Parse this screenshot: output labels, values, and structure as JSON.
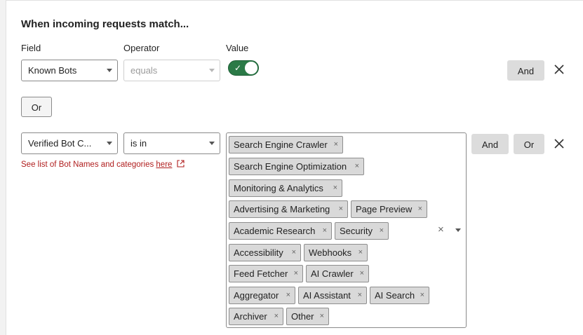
{
  "section": {
    "title": "When incoming requests match..."
  },
  "labels": {
    "field": "Field",
    "operator": "Operator",
    "value": "Value"
  },
  "row1": {
    "field": "Known Bots",
    "operator": "equals",
    "toggle_on": true,
    "and_label": "And"
  },
  "or_label": "Or",
  "row2": {
    "field": "Verified Bot C...",
    "operator": "is in",
    "note_text": "See list of Bot Names and categories ",
    "note_link": "here",
    "and_label": "And",
    "or_label": "Or",
    "chips": [
      "Search Engine Crawler",
      "Search Engine Optimization",
      "Monitoring & Analytics",
      "Advertising & Marketing",
      "Page Preview",
      "Academic Research",
      "Security",
      "Accessibility",
      "Webhooks",
      "Feed Fetcher",
      "AI Crawler",
      "Aggregator",
      "AI Assistant",
      "AI Search",
      "Archiver",
      "Other"
    ]
  },
  "icons": {
    "remove": "close-icon",
    "chip_remove": "×",
    "clear": "×",
    "external": "external-link-icon"
  },
  "colors": {
    "toggle_on": "#2b7a47",
    "link": "#b01e1e",
    "chip_bg": "#d9d9d9"
  }
}
